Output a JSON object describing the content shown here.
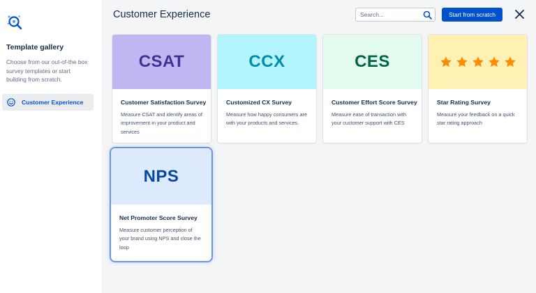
{
  "sidebar": {
    "title": "Template gallery",
    "description": "Choose from our out-of-the box survey templates or start building from scratch.",
    "items": [
      {
        "label": "Customer Experience",
        "icon": "smiley-icon",
        "active": true
      }
    ]
  },
  "header": {
    "title": "Customer Experience",
    "search_placeholder": "Search...",
    "primary_button": "Start from scratch"
  },
  "cards": [
    {
      "acronym": "CSAT",
      "title": "Customer Satisfaction Survey",
      "description": "Measure CSAT and identify areas of improvement in your product and services",
      "banner_color": "#c0b6f2",
      "acronym_color": "#403294"
    },
    {
      "acronym": "CCX",
      "title": "Customized CX Survey",
      "description": "Measure how happy consumers are with your products and services.",
      "banner_color": "#b3f5ff",
      "acronym_color": "#008da6"
    },
    {
      "acronym": "CES",
      "title": "Customer Effort Score Survey",
      "description": "Measure ease of transaction with your customer support with CES",
      "banner_color": "#e3fcef",
      "acronym_color": "#006644"
    },
    {
      "acronym": "",
      "title": "Star Rating Survey",
      "description": "Measure your feedback on a quick star rating approach",
      "banner_color": "#fff0b3",
      "star_color": "#ff8b00",
      "rating": 5
    },
    {
      "acronym": "NPS",
      "title": "Net Promoter Score Survey",
      "description": "Measure customer perception of your brand using NPS and close the loop",
      "banner_color": "#deebff",
      "acronym_color": "#0747a6",
      "selected": true
    }
  ]
}
